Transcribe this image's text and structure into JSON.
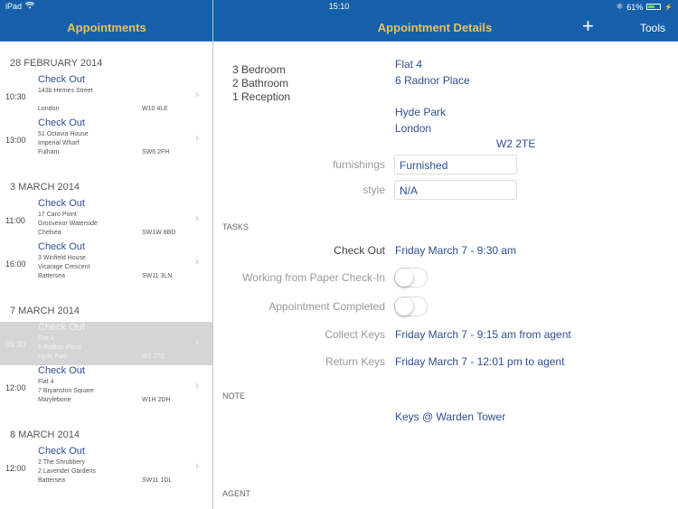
{
  "status_bar": {
    "device": "iPad",
    "time": "15:10",
    "battery": "61%",
    "battery_level": 0.61
  },
  "nav": {
    "master_title": "Appointments",
    "detail_title": "Appointment Details",
    "add_icon": "plus-icon",
    "tools_label": "Tools"
  },
  "colors": {
    "nav_bar": "#1660ab",
    "nav_title": "#e8c35a",
    "link_text": "#2f4f92",
    "selected_row": "#d5d5d5"
  },
  "appointments": {
    "sections": [
      {
        "date": "28 FEBRUARY 2014",
        "items": [
          {
            "time": "10:30",
            "title": "Check Out",
            "line1": "143b Herries Street",
            "line2": "",
            "line3": "London",
            "postcode": "W10 4LE",
            "selected": false
          },
          {
            "time": "13:00",
            "title": "Check Out",
            "line1": "51 Octavia House",
            "line2": "Imperial Wharf",
            "line3": "Fulham",
            "postcode": "SW6 2FH",
            "selected": false
          }
        ]
      },
      {
        "date": "3 MARCH 2014",
        "items": [
          {
            "time": "11:00",
            "title": "Check Out",
            "line1": "17 Caro Point",
            "line2": "Grosvenor Waterside",
            "line3": "Chelsea",
            "postcode": "SW1W 8BD",
            "selected": false
          },
          {
            "time": "16:00",
            "title": "Check Out",
            "line1": "3 Winfield House",
            "line2": "Vicarage Crescent",
            "line3": "Battersea",
            "postcode": "SW11 3LN",
            "selected": false
          }
        ]
      },
      {
        "date": "7 MARCH 2014",
        "items": [
          {
            "time": "09:30",
            "title": "Check Out",
            "line1": "Flat 4",
            "line2": "6 Radnor Place",
            "line3": "Hyde Park",
            "postcode": "W2 2TE",
            "selected": true
          },
          {
            "time": "12:00",
            "title": "Check Out",
            "line1": "Flat 4",
            "line2": "7 Bryanston Square",
            "line3": "Marylebone",
            "postcode": "W1H 2DH",
            "selected": false
          }
        ]
      },
      {
        "date": "8 MARCH 2014",
        "items": [
          {
            "time": "12:00",
            "title": "Check Out",
            "line1": "2 The Shrubbery",
            "line2": "2 Lavender Gardens",
            "line3": "Battersea",
            "postcode": "SW11 1DL",
            "selected": false
          }
        ]
      }
    ]
  },
  "detail": {
    "rooms": [
      "3 Bedroom",
      "2 Bathroom",
      "1 Reception"
    ],
    "address": {
      "line1": "Flat 4",
      "line2": "6 Radnor Place",
      "area": "Hyde Park",
      "city": "London",
      "postcode": "W2 2TE"
    },
    "furnishings_label": "furnishings",
    "furnishings_value": "Furnished",
    "style_label": "style",
    "style_value": "N/A",
    "tasks_header": "TASKS",
    "check_out_label": "Check Out",
    "check_out_value": "Friday March 7 - 9:30 am",
    "paper_checkin_label": "Working from Paper Check-In",
    "paper_checkin_on": false,
    "completed_label": "Appointment Completed",
    "completed_on": false,
    "collect_keys_label": "Collect Keys",
    "collect_keys_value": "Friday March 7 - 9:15 am from agent",
    "return_keys_label": "Return Keys",
    "return_keys_value": "Friday March 7 - 12:01 pm to agent",
    "note_header": "NOTE",
    "note_value": "Keys @ Warden Tower",
    "agent_header": "AGENT"
  }
}
